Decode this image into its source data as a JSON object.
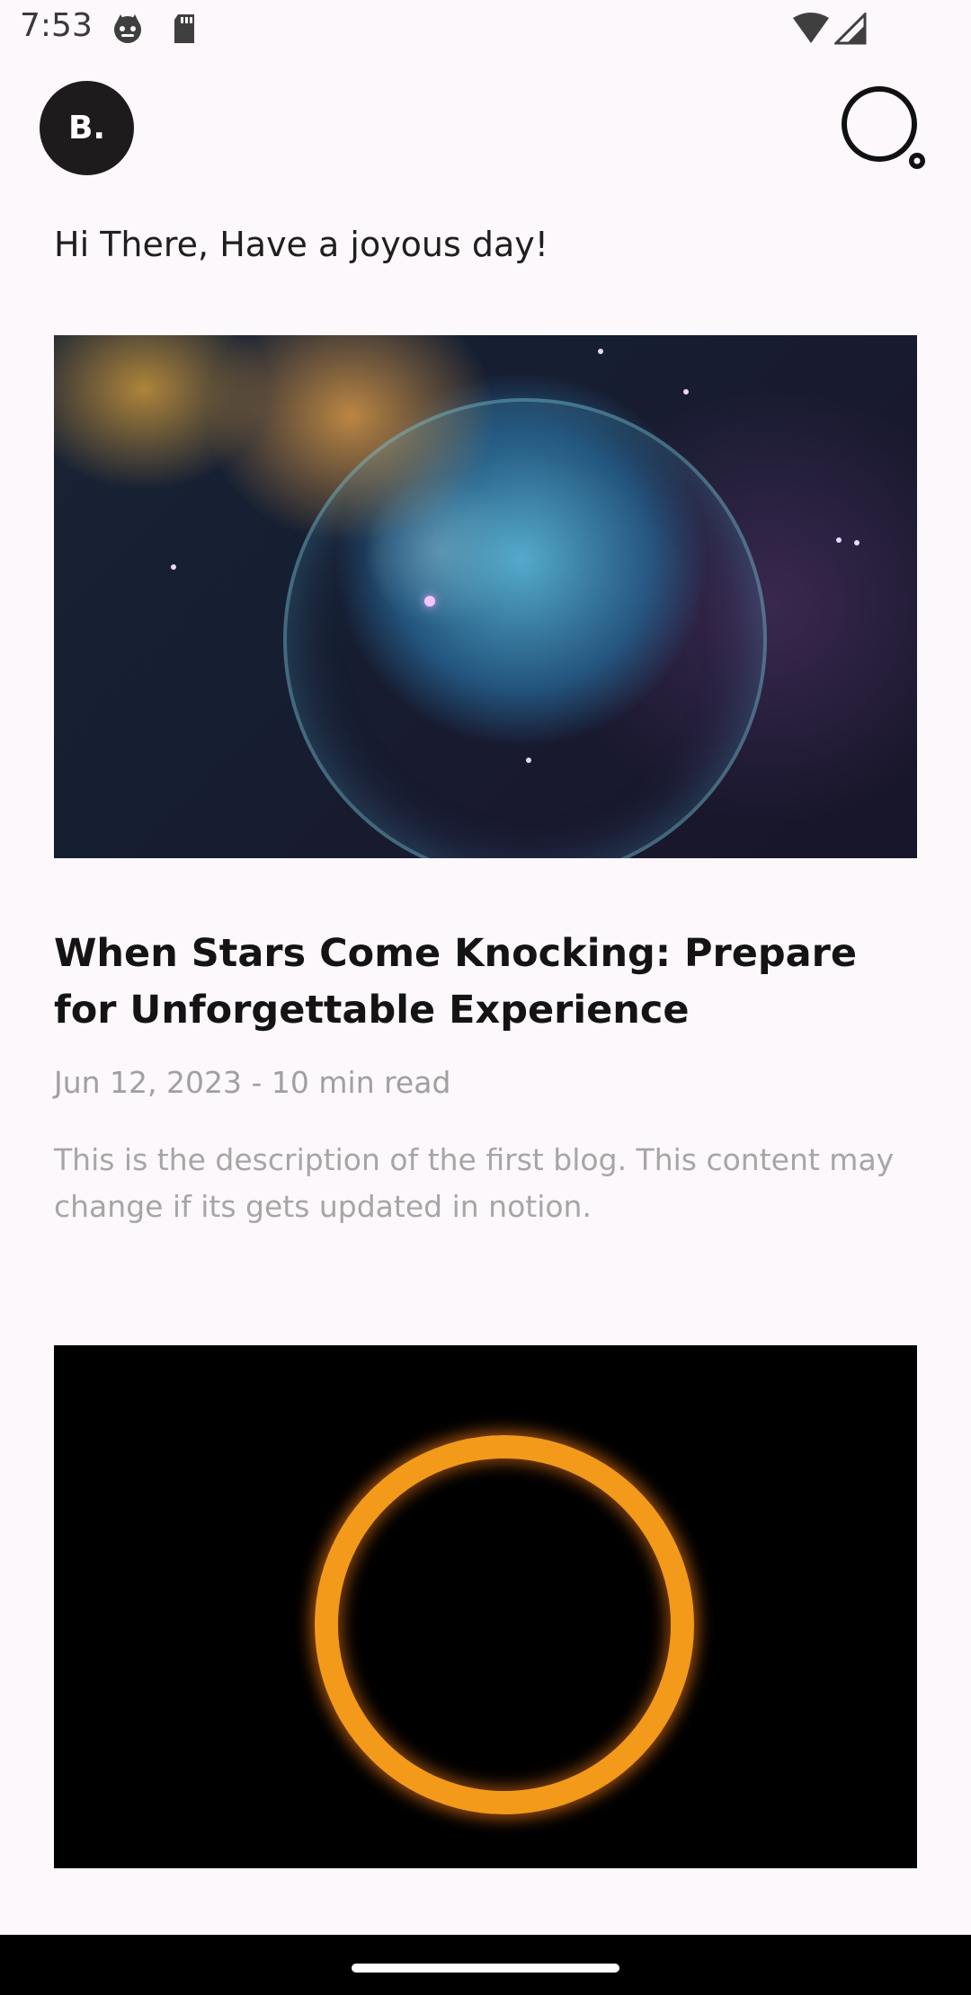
{
  "status_bar": {
    "time": "7:53"
  },
  "header": {
    "logo_text": "B.",
    "search_icon": "search-icon"
  },
  "greeting": "Hi There, Have a joyous day!",
  "posts": [
    {
      "title": "When Stars Come Knocking: Prepare for Unforgettable Experience",
      "meta": "Jun 12, 2023 - 10 min read",
      "description": "This is the description of the first blog. This content may change if its gets updated in notion.",
      "image": "nebula-image"
    },
    {
      "image": "fire-ring-image"
    }
  ]
}
